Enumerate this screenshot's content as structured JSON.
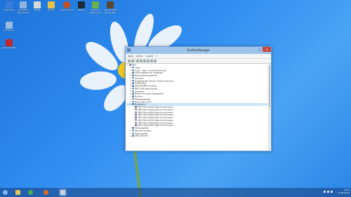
{
  "desktop": {
    "icons": [
      {
        "label": "SmartScan",
        "color": "#3a7dd8"
      },
      {
        "label": "VirtualBox Meerwerke",
        "color": "#8fb4e0"
      },
      {
        "label": "Nesse",
        "color": "#d9d9d9"
      },
      {
        "label": "Smart",
        "color": "#e3c24a"
      },
      {
        "label": "mediaShrink",
        "color": "#c9501e"
      },
      {
        "label": "Steam",
        "color": "#1f2a38"
      },
      {
        "label": "GeForce Experience",
        "color": "#6ab04c"
      },
      {
        "label": "Call of Duty World War",
        "color": "#5b4630"
      },
      {
        "label": "Computer",
        "color": "#9bbbe0"
      },
      {
        "label": "Adobe Reader",
        "color": "#c0272d"
      }
    ]
  },
  "window": {
    "title": "Geräte-Manager",
    "menu": [
      "Datei",
      "Aktion",
      "Ansicht",
      "?"
    ],
    "tree": [
      {
        "label": "Pete",
        "level": 0,
        "open": true
      },
      {
        "label": "Akkus",
        "level": 1
      },
      {
        "label": "Audio-, Video- und Gamecontroller",
        "level": 1
      },
      {
        "label": "Audioeingänge und -ausgänge",
        "level": 1
      },
      {
        "label": "Bildverarbeitungsgeräte",
        "level": 1
      },
      {
        "label": "Computer",
        "level": 1
      },
      {
        "label": "Eingabegeräte (Human Interface Devices)",
        "level": 1
      },
      {
        "label": "Grafikkarten",
        "level": 1
      },
      {
        "label": "IDE ATA/ATAPI-Controller",
        "level": 1
      },
      {
        "label": "IEEE 1394 Hostcontroller",
        "level": 1
      },
      {
        "label": "Laufwerke",
        "level": 1
      },
      {
        "label": "Mäuse und andere Zeigegeräte",
        "level": 1
      },
      {
        "label": "Monitore",
        "level": 1
      },
      {
        "label": "Netzwerkadapter",
        "level": 1
      },
      {
        "label": "Ports (COM & LPT)",
        "level": 1
      },
      {
        "label": "Prozessoren",
        "level": 1,
        "open": true,
        "selected": true
      },
      {
        "label": "AMD FX(tm)-8320 Eight-Core Processor",
        "level": 2
      },
      {
        "label": "AMD FX(tm)-8320 Eight-Core Processor",
        "level": 2
      },
      {
        "label": "AMD FX(tm)-8320 Eight-Core Processor",
        "level": 2
      },
      {
        "label": "AMD FX(tm)-8320 Eight-Core Processor",
        "level": 2
      },
      {
        "label": "AMD FX(tm)-8320 Eight-Core Processor",
        "level": 2
      },
      {
        "label": "AMD FX(tm)-8320 Eight-Core Processor",
        "level": 2
      },
      {
        "label": "AMD FX(tm)-8320 Eight-Core Processor",
        "level": 2
      },
      {
        "label": "AMD FX(tm)-8320 Eight-Core Processor",
        "level": 2
      },
      {
        "label": "Softwaregeräte",
        "level": 1
      },
      {
        "label": "Speichercontroller",
        "level": 1
      },
      {
        "label": "Systemgeräte",
        "level": 1
      },
      {
        "label": "USB-Controller",
        "level": 1
      }
    ]
  },
  "taskbar": {
    "items": [
      "start",
      "explorer",
      "chrome",
      "firefox",
      "device-manager"
    ],
    "time": "13:45",
    "date": "23.08.2014"
  }
}
